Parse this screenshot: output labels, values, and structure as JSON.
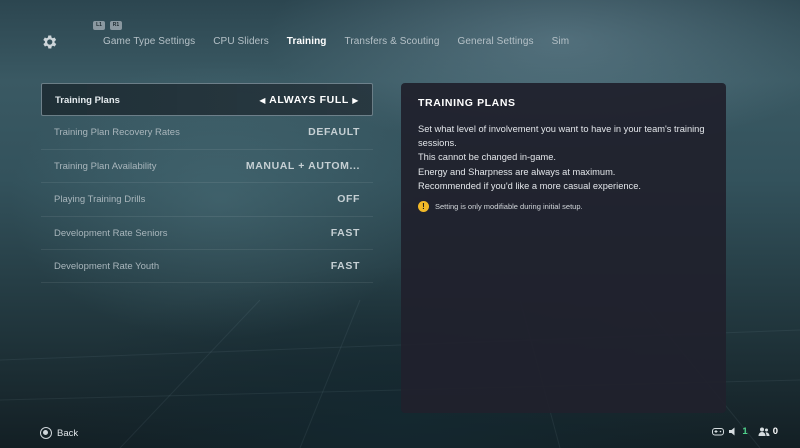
{
  "header": {
    "bumpers": [
      "L1",
      "R1"
    ],
    "tabs": [
      {
        "label": "Game Type Settings",
        "active": false
      },
      {
        "label": "CPU Sliders",
        "active": false
      },
      {
        "label": "Training",
        "active": true
      },
      {
        "label": "Transfers & Scouting",
        "active": false
      },
      {
        "label": "General Settings",
        "active": false
      },
      {
        "label": "Sim",
        "active": false
      }
    ],
    "settings_icon": "gear-icon"
  },
  "settings": [
    {
      "label": "Training Plans",
      "value": "ALWAYS FULL",
      "selected": true
    },
    {
      "label": "Training Plan Recovery Rates",
      "value": "DEFAULT",
      "selected": false
    },
    {
      "label": "Training Plan Availability",
      "value": "MANUAL + AUTOM...",
      "selected": false
    },
    {
      "label": "Playing Training Drills",
      "value": "OFF",
      "selected": false
    },
    {
      "label": "Development Rate Seniors",
      "value": "FAST",
      "selected": false
    },
    {
      "label": "Development Rate Youth",
      "value": "FAST",
      "selected": false
    }
  ],
  "info_panel": {
    "title": "TRAINING PLANS",
    "lines": [
      "Set what level of involvement you want to have in your team's training sessions.",
      "This cannot be changed in-game.",
      "Energy and Sharpness are always at maximum.",
      "Recommended if you'd like a more casual experience."
    ],
    "note": "Setting is only modifiable during initial setup.",
    "note_icon": "warning-icon"
  },
  "footer": {
    "back_label": "Back",
    "status": [
      {
        "icon": "controller-icon",
        "count": "1"
      },
      {
        "icon": "users-icon",
        "count": "0"
      }
    ]
  },
  "colors": {
    "panel_bg": "#20212d",
    "accent_warn": "#f2b928",
    "status_green": "#4fd18a"
  }
}
